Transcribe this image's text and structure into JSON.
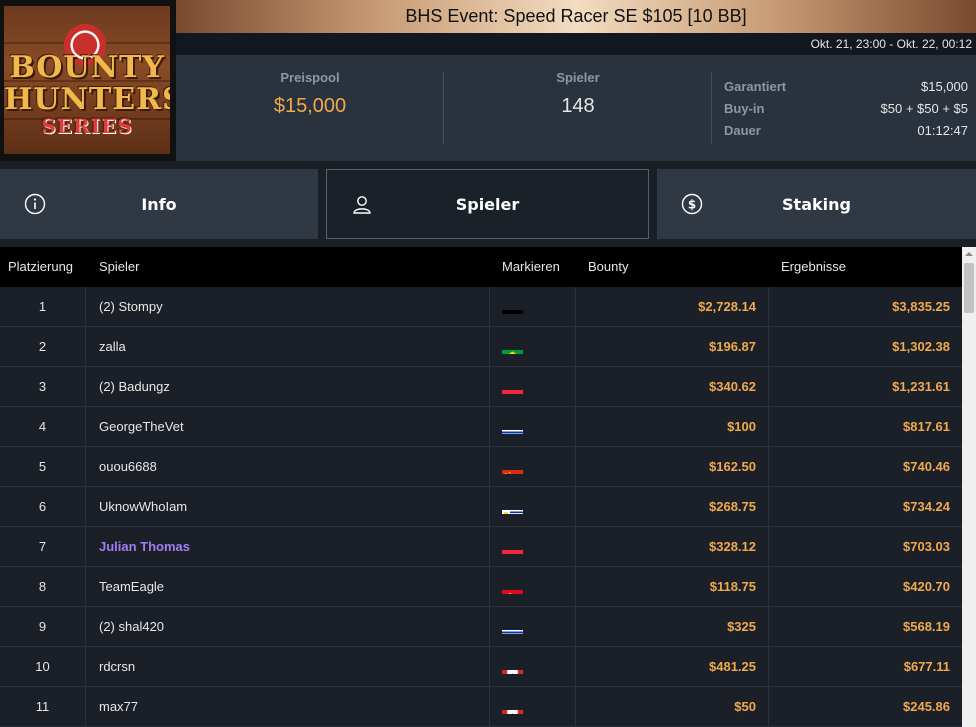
{
  "logo": {
    "line1": "BOUNTY",
    "line2": "HUNTERS",
    "line3": "SERIES"
  },
  "title": "BHS Event: Speed Racer SE $105 [10 BB]",
  "dates": "Okt. 21, 23:00 - Okt. 22, 00:12",
  "stats": {
    "prizepool_label": "Preispool",
    "prizepool_value": "$15,000",
    "players_label": "Spieler",
    "players_value": "148"
  },
  "details": [
    {
      "label": "Garantiert",
      "value": "$15,000"
    },
    {
      "label": "Buy-in",
      "value": "$50 + $50 + $5"
    },
    {
      "label": "Dauer",
      "value": "01:12:47"
    }
  ],
  "tabs": [
    {
      "label": "Info",
      "icon": "info-icon"
    },
    {
      "label": "Spieler",
      "icon": "user-icon",
      "active": true
    },
    {
      "label": "Staking",
      "icon": "dollar-circle-icon"
    }
  ],
  "table": {
    "headers": {
      "rank": "Platzierung",
      "player": "Spieler",
      "flag": "Markieren",
      "bounty": "Bounty",
      "result": "Ergebnisse"
    },
    "rows": [
      {
        "rank": "1",
        "name": "(2) Stompy",
        "flag": "de",
        "bounty": "$2,728.14",
        "result": "$3,835.25"
      },
      {
        "rank": "2",
        "name": "zalla",
        "flag": "br",
        "bounty": "$196.87",
        "result": "$1,302.38"
      },
      {
        "rank": "3",
        "name": "(2) Badungz",
        "flag": "lu",
        "bounty": "$340.62",
        "result": "$1,231.61"
      },
      {
        "rank": "4",
        "name": "GeorgeTheVet",
        "flag": "il",
        "bounty": "$100",
        "result": "$817.61"
      },
      {
        "rank": "5",
        "name": "ouou6688",
        "flag": "cn",
        "bounty": "$162.50",
        "result": "$740.46"
      },
      {
        "rank": "6",
        "name": "UknowWhoIam",
        "flag": "uy",
        "bounty": "$268.75",
        "result": "$734.24"
      },
      {
        "rank": "7",
        "name": "Julian Thomas",
        "flag": "at",
        "bounty": "$328.12",
        "result": "$703.03",
        "highlight": true
      },
      {
        "rank": "8",
        "name": "TeamEagle",
        "flag": "tr",
        "bounty": "$118.75",
        "result": "$420.70"
      },
      {
        "rank": "9",
        "name": "(2) shal420",
        "flag": "il",
        "bounty": "$325",
        "result": "$568.19"
      },
      {
        "rank": "10",
        "name": "rdcrsn",
        "flag": "ca",
        "bounty": "$481.25",
        "result": "$677.11"
      },
      {
        "rank": "11",
        "name": "max77",
        "flag": "ca",
        "bounty": "$50",
        "result": "$245.86"
      }
    ]
  },
  "colors": {
    "accent": "#f0a94c",
    "highlight_player": "#a27cf2"
  }
}
